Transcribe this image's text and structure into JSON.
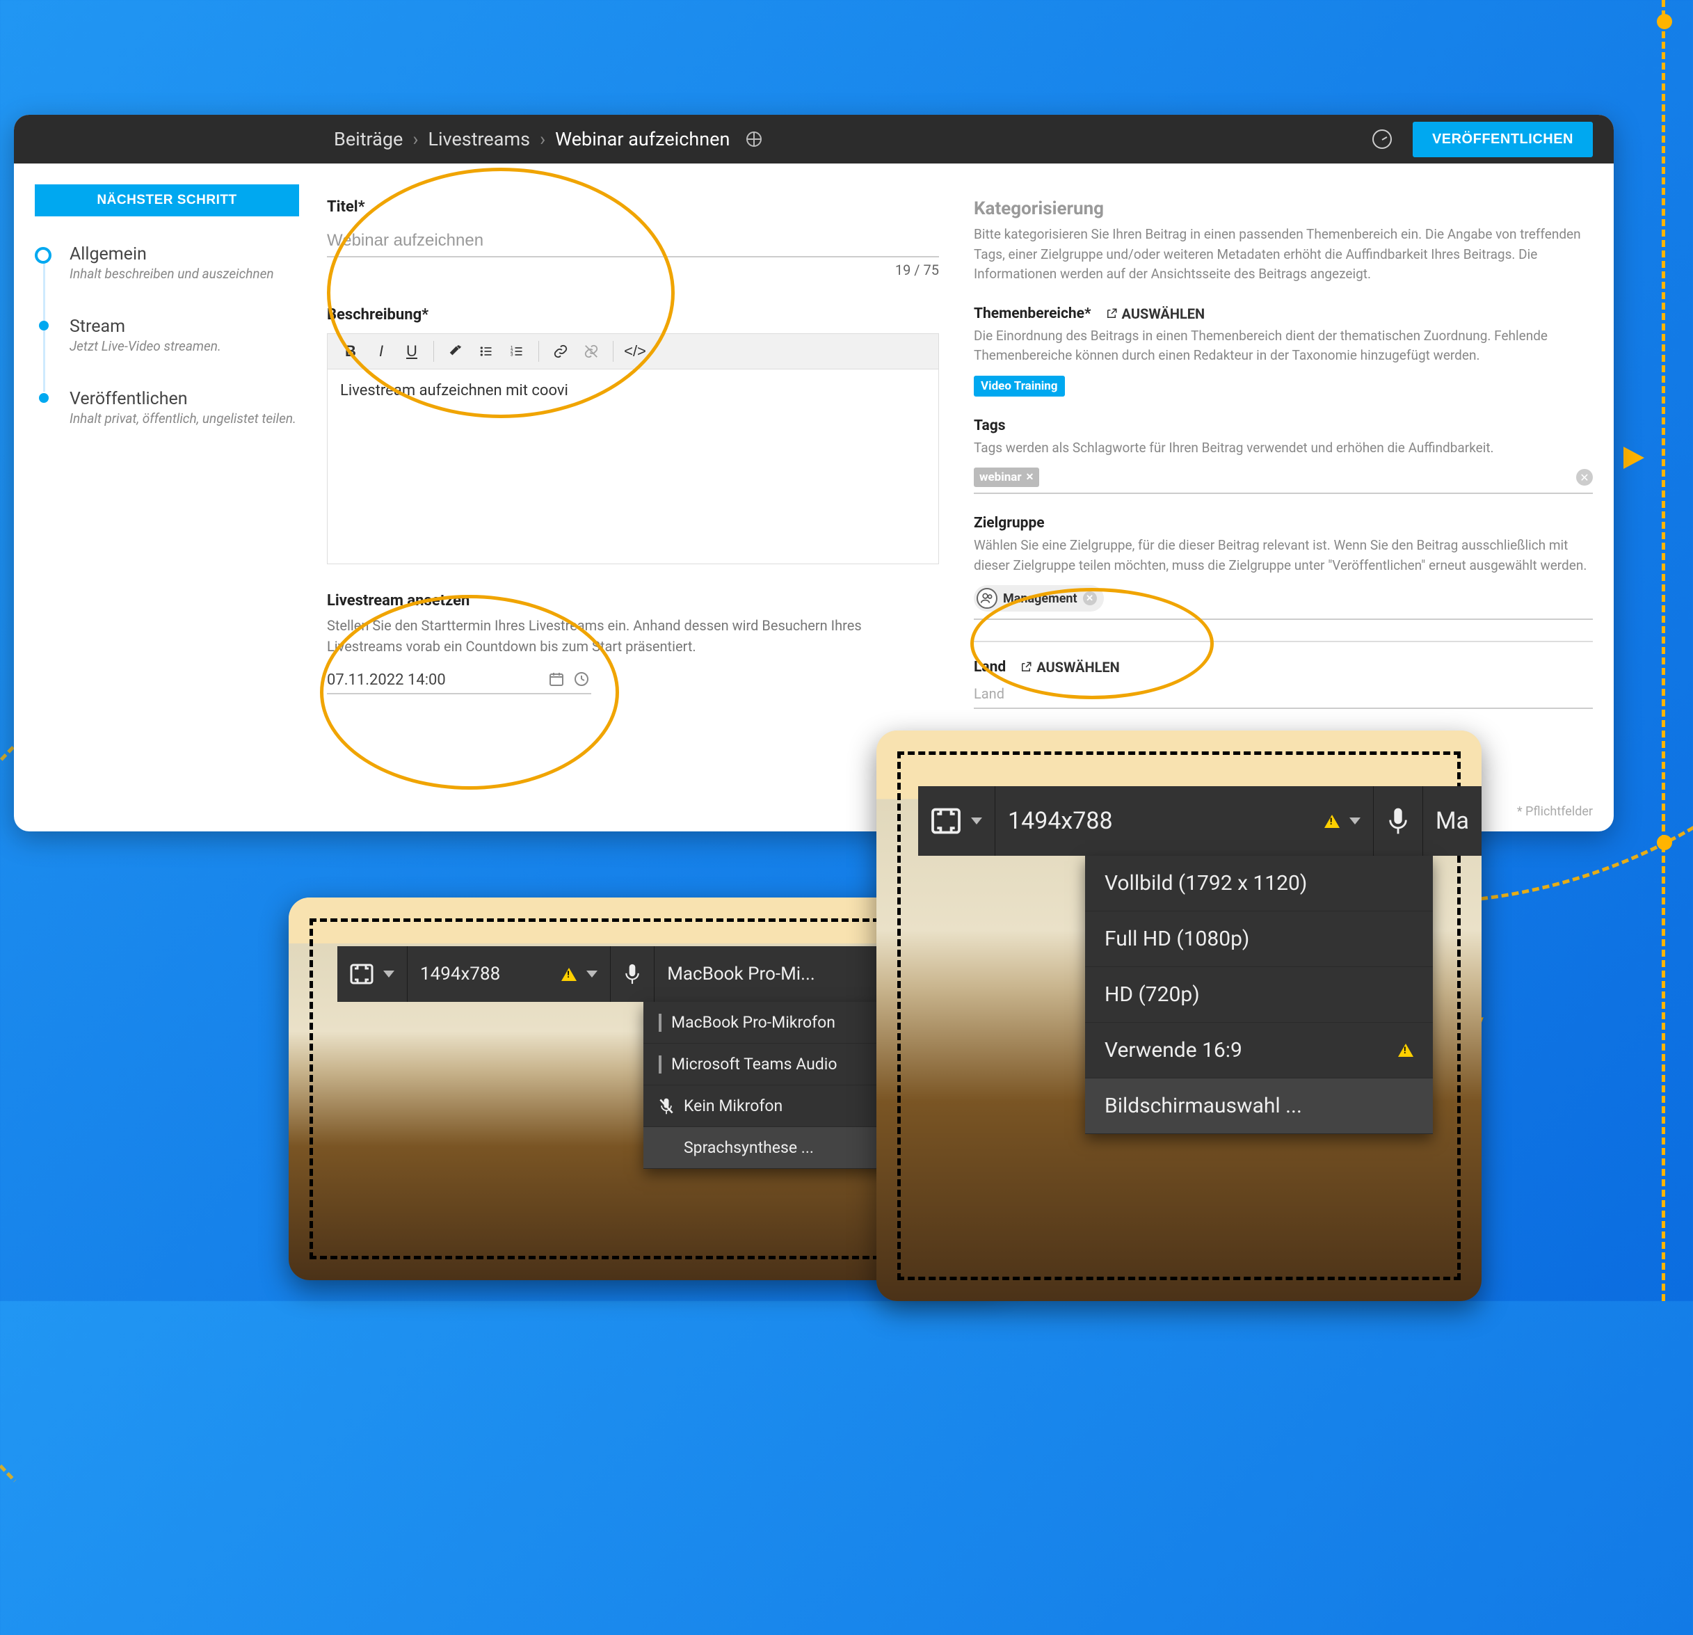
{
  "breadcrumb": {
    "a": "Beiträge",
    "b": "Livestreams",
    "c": "Webinar aufzeichnen"
  },
  "topbar": {
    "publish": "VERÖFFENTLICHEN"
  },
  "sidebar": {
    "next_step": "NÄCHSTER SCHRITT",
    "steps": [
      {
        "title": "Allgemein",
        "desc": "Inhalt beschreiben und auszeichnen"
      },
      {
        "title": "Stream",
        "desc": "Jetzt Live-Video streamen."
      },
      {
        "title": "Veröffentlichen",
        "desc": "Inhalt privat, öffentlich, ungelistet teilen."
      }
    ]
  },
  "form": {
    "title_label": "Titel*",
    "title_value": "Webinar aufzeichnen",
    "char_count": "19 / 75",
    "desc_label": "Beschreibung*",
    "desc_value": "Livestream aufzeichnen mit coovi",
    "schedule_heading": "Livestream ansetzen",
    "schedule_desc": "Stellen Sie den Starttermin Ihres Livestreams ein. Anhand dessen wird Besuchern Ihres Livestreams vorab ein Countdown bis zum Start präsentiert.",
    "schedule_value": "07.11.2022 14:00"
  },
  "right": {
    "cat_h": "Kategorisierung",
    "cat_p": "Bitte kategorisieren Sie Ihren Beitrag in einen passenden Themenbereich ein. Die Angabe von treffenden Tags, einer Zielgruppe und/oder weiteren Metadaten erhöht die Auffindbarkeit Ihres Beitrags. Die Informationen werden auf der Ansichtsseite des Beitrags angezeigt.",
    "themen_label": "Themenbereiche*",
    "select_label": "AUSWÄHLEN",
    "themen_desc": "Die Einordnung des Beitrags in einen Themenbereich dient der thematischen Zuordnung. Fehlende Themenbereiche können durch einen Redakteur in der Taxonomie hinzugefügt werden.",
    "themen_chip": "Video Training",
    "tags_label": "Tags",
    "tags_desc": "Tags werden als Schlagworte für Ihren Beitrag verwendet und erhöhen die Auffindbarkeit.",
    "tag_value": "webinar",
    "ziel_label": "Zielgruppe",
    "ziel_desc": "Wählen Sie eine Zielgruppe, für die dieser Beitrag relevant ist. Wenn Sie den Beitrag ausschließlich mit dieser Zielgruppe teilen möchten, muss die Zielgruppe unter \"Veröffentlichen\" erneut ausgewählt werden.",
    "ziel_chip": "Management",
    "land_label": "Land",
    "land_placeholder": "Land",
    "footnote": "* Pflichtfelder"
  },
  "rec_small": {
    "resolution": "1494x788",
    "mic_label": "MacBook Pro-Mi...",
    "menu": {
      "opt1": "MacBook Pro-Mikrofon",
      "opt2": "Microsoft Teams Audio",
      "opt3": "Kein Mikrofon",
      "opt4": "Sprachsynthese ..."
    }
  },
  "rec_large": {
    "resolution": "1494x788",
    "mic_short": "Ma",
    "menu": {
      "opt1": "Vollbild (1792 x 1120)",
      "opt2": "Full HD (1080p)",
      "opt3": "HD (720p)",
      "opt4": "Verwende 16:9",
      "opt5": "Bildschirmauswahl ..."
    }
  }
}
